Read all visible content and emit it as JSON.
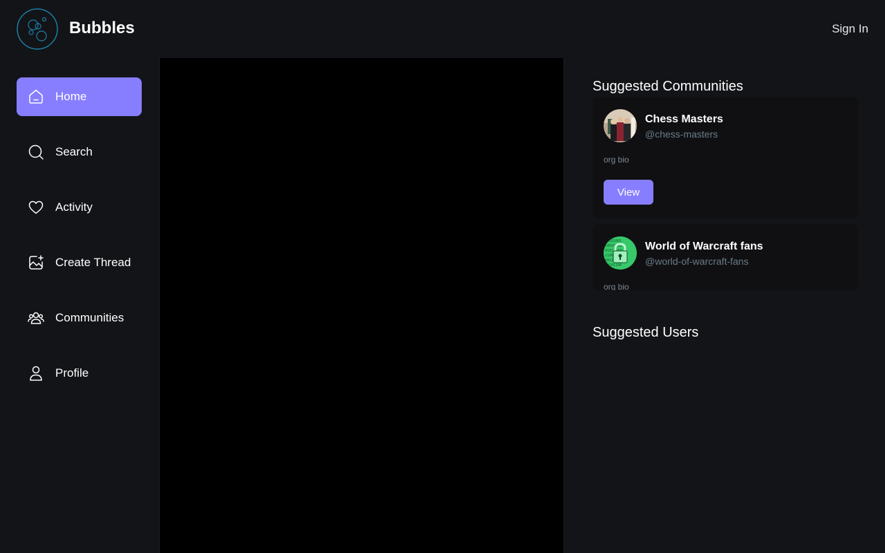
{
  "header": {
    "brand": "Bubbles",
    "sign_in": "Sign In"
  },
  "sidebar": {
    "items": [
      {
        "label": "Home",
        "icon": "home-icon",
        "active": true
      },
      {
        "label": "Search",
        "icon": "search-icon",
        "active": false
      },
      {
        "label": "Activity",
        "icon": "heart-icon",
        "active": false
      },
      {
        "label": "Create Thread",
        "icon": "create-thread-icon",
        "active": false
      },
      {
        "label": "Communities",
        "icon": "communities-icon",
        "active": false
      },
      {
        "label": "Profile",
        "icon": "profile-icon",
        "active": false
      }
    ]
  },
  "rightbar": {
    "communities_title": "Suggested Communities",
    "communities": [
      {
        "name": "Chess Masters",
        "handle": "@chess-masters",
        "bio": "org bio",
        "button": "View"
      },
      {
        "name": "World of Warcraft fans",
        "handle": "@world-of-warcraft-fans",
        "bio": "org bio"
      }
    ],
    "users_title": "Suggested Users"
  },
  "colors": {
    "accent": "#877eff",
    "background": "#121417",
    "feed": "#000000",
    "card": "#101012",
    "muted": "#697c89"
  }
}
